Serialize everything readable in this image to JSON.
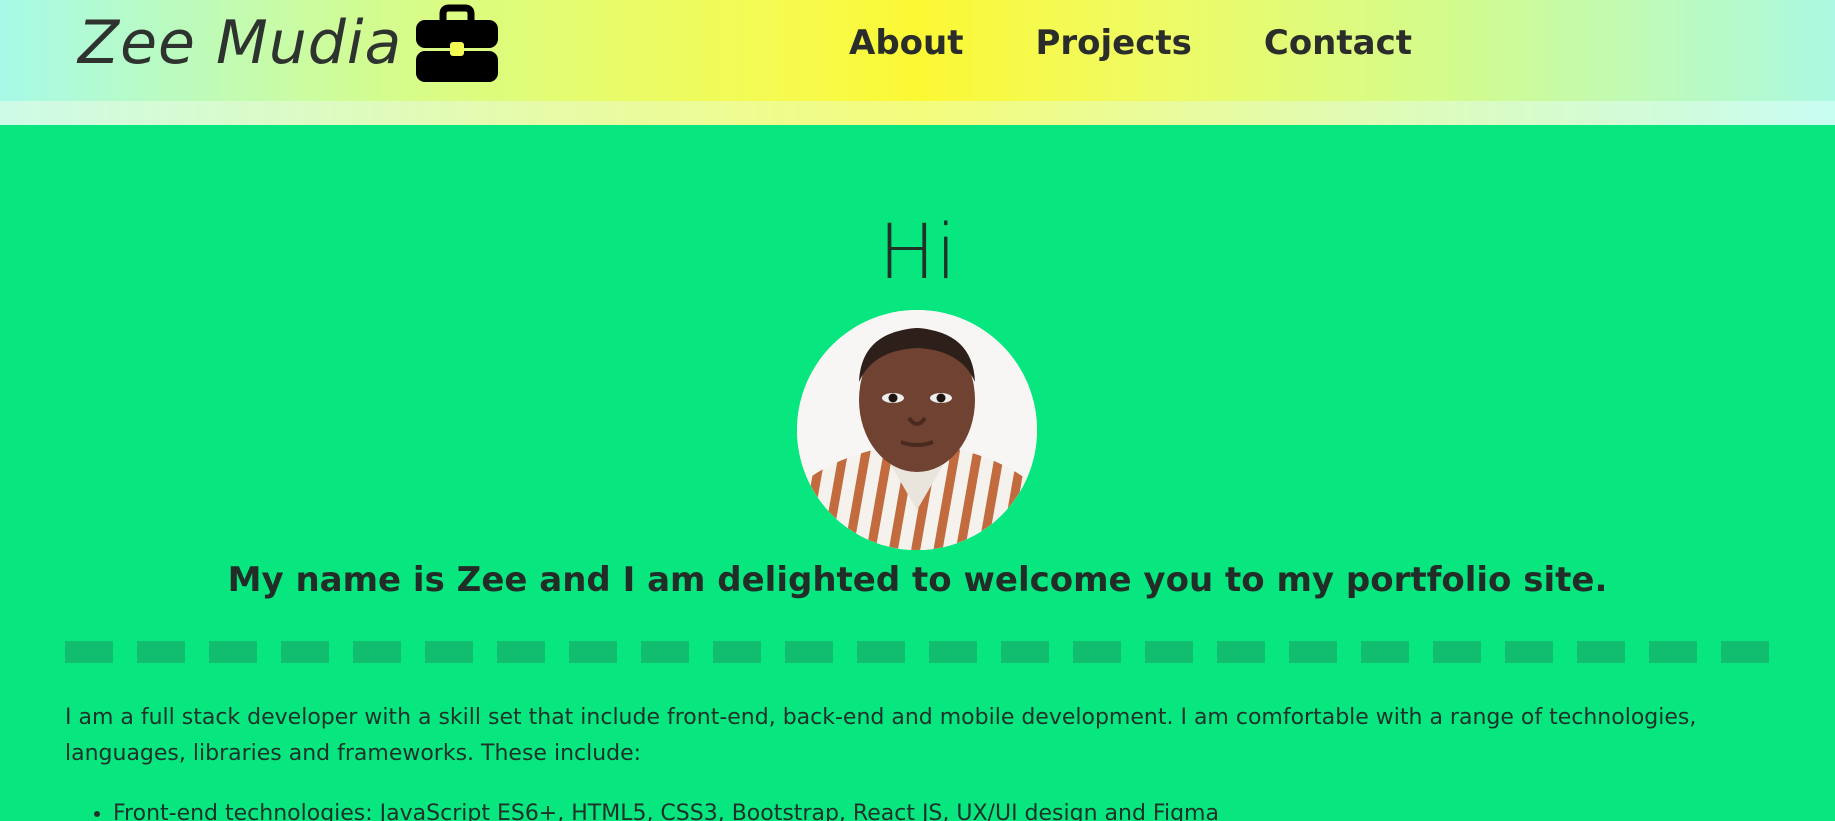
{
  "header": {
    "brand": "Zee Mudia",
    "brand_icon": "briefcase-icon",
    "nav": [
      "About",
      "Projects",
      "Contact"
    ]
  },
  "hero": {
    "title": "Hi",
    "avatar": "profile-photo",
    "welcome": "My name is Zee and I am delighted to welcome you to my portfolio site."
  },
  "intro": {
    "text": "I am a full stack developer with a skill set that include front-end, back-end and mobile development. I am comfortable with a range of technologies, languages, libraries and frameworks. These include:",
    "items": [
      "Front-end technologies: JavaScript ES6+, HTML5, CSS3, Bootstrap, React JS, UX/UI design and Figma"
    ]
  },
  "colors": {
    "background": "#08e680",
    "divider": "#11be70",
    "text": "#22302a"
  }
}
